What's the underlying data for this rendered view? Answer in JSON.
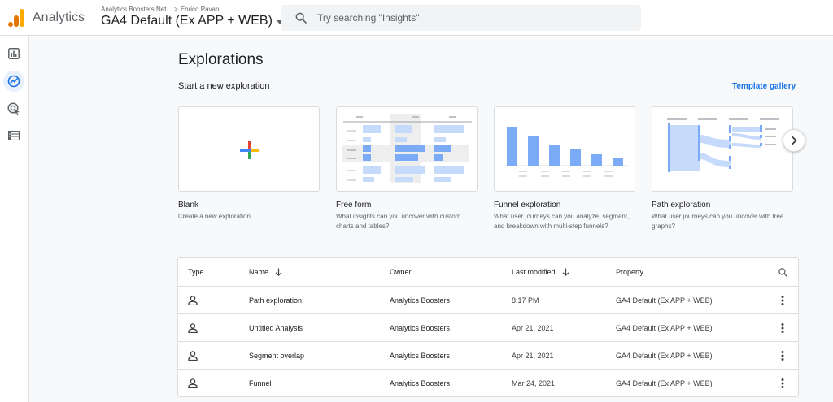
{
  "app": {
    "name": "Analytics",
    "breadcrumb_account": "Analytics Boosters Net...",
    "breadcrumb_separator": ">",
    "breadcrumb_user": "Enrico Pavan",
    "property_name": "GA4 Default (Ex APP + WEB)",
    "logo_icon": "analytics-logo-icon"
  },
  "search": {
    "placeholder": "Try searching \"Insights\"",
    "icon": "search-icon"
  },
  "nav": {
    "items": [
      {
        "icon": "reports-icon",
        "active": false
      },
      {
        "icon": "explore-icon",
        "active": true
      },
      {
        "icon": "advertising-icon",
        "active": false
      },
      {
        "icon": "configure-icon",
        "active": false
      }
    ]
  },
  "page": {
    "title": "Explorations",
    "subtitle": "Start a new exploration",
    "template_gallery": "Template gallery"
  },
  "templates": [
    {
      "name": "Blank",
      "description": "Create a new exploration"
    },
    {
      "name": "Free form",
      "description": "What insights can you uncover with custom charts and tables?"
    },
    {
      "name": "Funnel exploration",
      "description": "What user journeys can you analyze, segment, and breakdown with multi-step funnels?"
    },
    {
      "name": "Path exploration",
      "description": "What user journeys can you uncover with tree graphs?"
    }
  ],
  "table": {
    "headers": {
      "type": "Type",
      "name": "Name",
      "owner": "Owner",
      "last_modified": "Last modified",
      "property": "Property"
    },
    "rows": [
      {
        "name": "Path exploration",
        "owner": "Analytics Boosters",
        "last_modified": "8:17 PM",
        "property": "GA4 Default (Ex APP + WEB)"
      },
      {
        "name": "Untitled Analysis",
        "owner": "Analytics Boosters",
        "last_modified": "Apr 21, 2021",
        "property": "GA4 Default (Ex APP + WEB)"
      },
      {
        "name": "Segment overlap",
        "owner": "Analytics Boosters",
        "last_modified": "Apr 21, 2021",
        "property": "GA4 Default (Ex APP + WEB)"
      },
      {
        "name": "Funnel",
        "owner": "Analytics Boosters",
        "last_modified": "Mar 24, 2021",
        "property": "GA4 Default (Ex APP + WEB)"
      }
    ]
  },
  "colors": {
    "accent": "#1a73e8",
    "thumb_blue": "#7baaf7",
    "thumb_light": "#c6dafc",
    "logo_orange": "#f9ab00",
    "logo_dark": "#e37400"
  }
}
